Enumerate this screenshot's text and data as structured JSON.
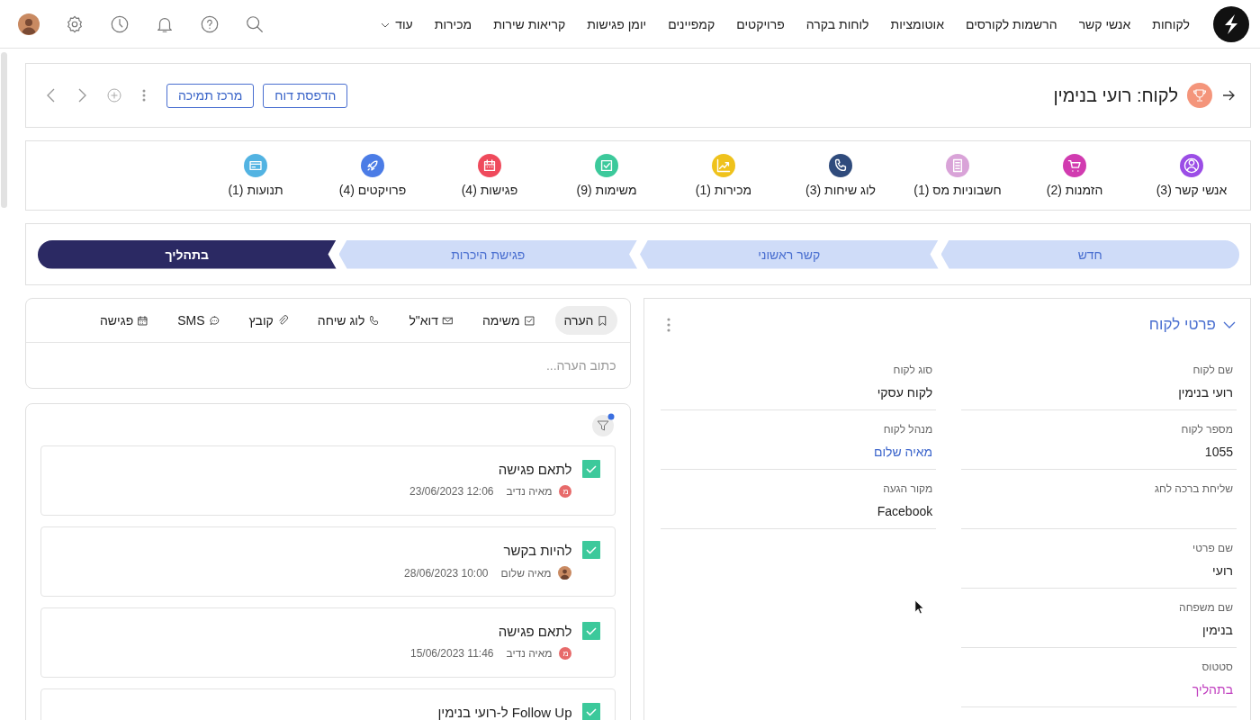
{
  "nav": {
    "items": [
      "לקוחות",
      "אנשי קשר",
      "הרשמות לקורסים",
      "אוטומציות",
      "לוחות בקרה",
      "פרויקטים",
      "קמפיינים",
      "יומן פגישות",
      "קריאות שירות",
      "מכירות"
    ],
    "more": "עוד"
  },
  "header": {
    "title": "לקוח: רועי בנימין",
    "buttons": [
      "הדפסת דוח",
      "מרכז תמיכה"
    ]
  },
  "related": [
    {
      "label": "אנשי קשר (3)",
      "color": "#9b4de6"
    },
    {
      "label": "הזמנות (2)",
      "color": "#d13bb0"
    },
    {
      "label": "חשבוניות מס (1)",
      "color": "#d9a3d8"
    },
    {
      "label": "לוג שיחות (3)",
      "color": "#2f4b7c"
    },
    {
      "label": "מכירות (1)",
      "color": "#efc21c"
    },
    {
      "label": "משימות (9)",
      "color": "#3cc99b"
    },
    {
      "label": "פגישות (4)",
      "color": "#ef4a5c"
    },
    {
      "label": "פרויקטים (4)",
      "color": "#4b7ce6"
    },
    {
      "label": "תנועות (1)",
      "color": "#52b3e2"
    }
  ],
  "pipeline": [
    {
      "label": "חדש",
      "selected": false
    },
    {
      "label": "קשר ראשוני",
      "selected": false
    },
    {
      "label": "פגישת היכרות",
      "selected": false
    },
    {
      "label": "בתהליך",
      "selected": true
    }
  ],
  "composer": {
    "tabs": [
      {
        "label": "הערה",
        "selected": true
      },
      {
        "label": "משימה",
        "selected": false
      },
      {
        "label": "דוא\"ל",
        "selected": false
      },
      {
        "label": "לוג שיחה",
        "selected": false
      },
      {
        "label": "קובץ",
        "selected": false
      },
      {
        "label": "SMS",
        "selected": false
      },
      {
        "label": "פגישה",
        "selected": false
      }
    ],
    "placeholder": "כתוב הערה..."
  },
  "feed": {
    "filter_active": true,
    "tasks": [
      {
        "title": "לתאם פגישה",
        "done": true,
        "user": "מאיה נדיב",
        "avatar": {
          "kind": "initial",
          "text": "מ"
        },
        "datetime": "23/06/2023 12:06"
      },
      {
        "title": "להיות בקשר",
        "done": true,
        "user": "מאיה שלום",
        "avatar": {
          "kind": "photo"
        },
        "datetime": "28/06/2023 10:00"
      },
      {
        "title": "לתאם פגישה",
        "done": true,
        "user": "מאיה נדיב",
        "avatar": {
          "kind": "initial",
          "text": "מ"
        },
        "datetime": "15/06/2023 11:46"
      },
      {
        "title": "Follow Up ל-רועי בנימין",
        "done": true
      }
    ]
  },
  "details": {
    "title": "פרטי לקוח",
    "expanded": true,
    "columns": [
      [
        {
          "label": "שם לקוח",
          "value": "רועי בנימין",
          "kind": "text"
        },
        {
          "label": "מספר לקוח",
          "value": "1055",
          "kind": "text"
        },
        {
          "label": "שליחת ברכה לחג"
        },
        {
          "label": "שם פרטי",
          "value": "רועי",
          "kind": "text"
        },
        {
          "label": "שם משפחה",
          "value": "בנימין",
          "kind": "text"
        },
        {
          "label": "סטטוס",
          "value": "בתהליך",
          "kind": "status"
        }
      ],
      [
        {
          "label": "סוג לקוח",
          "value": "לקוח עסקי",
          "kind": "text"
        },
        {
          "label": "מנהל לקוח",
          "value": "מאיה שלום",
          "kind": "link"
        },
        {
          "label": "מקור הגעה",
          "value": "Facebook",
          "kind": "text"
        }
      ]
    ]
  }
}
